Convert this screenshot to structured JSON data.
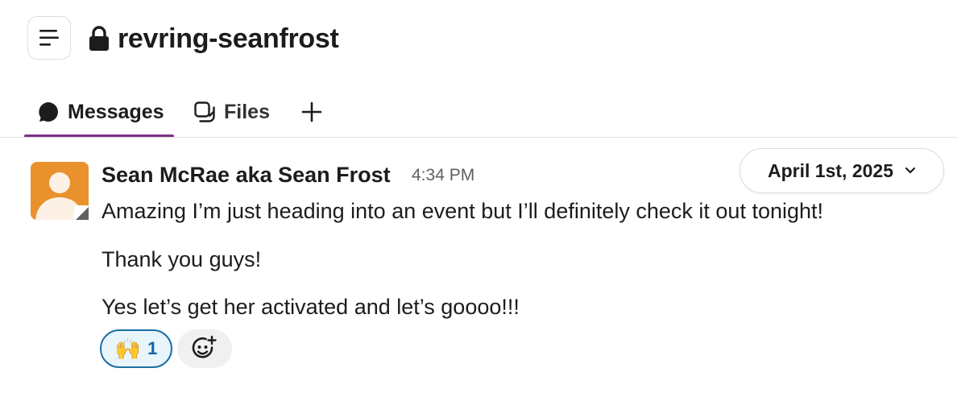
{
  "header": {
    "channel_name": "revring-seanfrost"
  },
  "tabs": [
    {
      "label": "Messages",
      "active": true
    },
    {
      "label": "Files",
      "active": false
    }
  ],
  "message": {
    "sender": "Sean McRae aka Sean Frost",
    "timestamp": "4:34 PM",
    "lines": [
      "Amazing I’m just heading into an event but I’ll definitely check it out tonight!",
      "Thank you guys!",
      "Yes let’s get her activated and let’s goooo!!!"
    ],
    "reactions": [
      {
        "emoji": "🙌",
        "count": "1"
      }
    ]
  },
  "date_divider": {
    "label": "April 1st, 2025"
  },
  "colors": {
    "accent_tab_underline": "#7c3085",
    "avatar_bg": "#e8912d",
    "reaction_border": "#1d6fa5",
    "reaction_bg": "#e8f5fa"
  },
  "icons": {
    "sidebar_toggle": "list-icon",
    "private_channel": "lock-icon",
    "messages_tab": "chat-bubble-icon",
    "files_tab": "files-icon",
    "add_tab": "plus-icon",
    "date_dropdown": "chevron-down-icon",
    "add_reaction": "add-emoji-icon"
  }
}
